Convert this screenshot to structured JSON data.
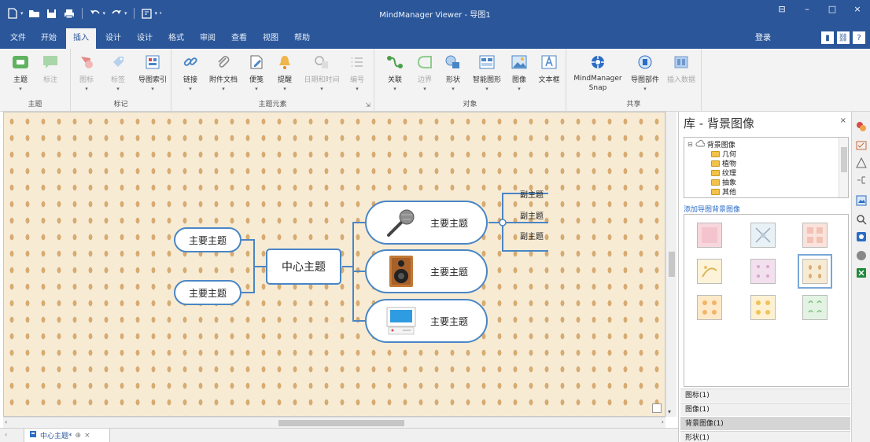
{
  "window": {
    "title": "MindManager Viewer - 导图1",
    "controls": [
      "⊟",
      "–",
      "□",
      "×"
    ]
  },
  "qat": {
    "icons": [
      "new-icon",
      "open-icon",
      "save-icon",
      "print-icon",
      "undo-icon",
      "redo-icon",
      "view-icon"
    ]
  },
  "tabs": [
    {
      "label": "文件",
      "active": false
    },
    {
      "label": "开始",
      "active": false
    },
    {
      "label": "插入",
      "active": true
    },
    {
      "label": "设计",
      "active": false
    },
    {
      "label": "设计",
      "active": false
    },
    {
      "label": "格式",
      "active": false
    },
    {
      "label": "审阅",
      "active": false
    },
    {
      "label": "查看",
      "active": false
    },
    {
      "label": "视图",
      "active": false
    },
    {
      "label": "帮助",
      "active": false
    }
  ],
  "signin": "登录",
  "ribbon": {
    "groups": [
      {
        "label": "主题",
        "buttons": [
          {
            "label": "主题",
            "icon": "topic-icon",
            "color": "#4aa04a",
            "disabled": false
          },
          {
            "label": "标注",
            "icon": "callout-icon",
            "color": "#4aa04a",
            "disabled": true
          }
        ]
      },
      {
        "label": "标记",
        "buttons": [
          {
            "label": "图标",
            "icon": "icon-marker-icon",
            "color": "#d94a4a",
            "disabled": true
          },
          {
            "label": "标签",
            "icon": "tag-icon",
            "color": "#4a86c5",
            "disabled": true
          },
          {
            "label": "导图索引",
            "icon": "index-icon",
            "color": "#4a86c5",
            "disabled": false
          }
        ]
      },
      {
        "label": "主题元素",
        "buttons": [
          {
            "label": "链接",
            "icon": "link-icon",
            "color": "#4a86c5",
            "disabled": false
          },
          {
            "label": "附件文档",
            "icon": "attachment-icon",
            "color": "#777777",
            "disabled": false
          },
          {
            "label": "便笺",
            "icon": "note-icon",
            "color": "#4a86c5",
            "disabled": false
          },
          {
            "label": "提醒",
            "icon": "alarm-icon",
            "color": "#e3a53a",
            "disabled": false
          },
          {
            "label": "日期和时间",
            "icon": "datetime-icon",
            "color": "#999999",
            "disabled": true
          },
          {
            "label": "编号",
            "icon": "numbering-icon",
            "color": "#999999",
            "disabled": true
          }
        ]
      },
      {
        "label": "对象",
        "buttons": [
          {
            "label": "关联",
            "icon": "relationship-icon",
            "color": "#4aa04a",
            "disabled": false
          },
          {
            "label": "边界",
            "icon": "boundary-icon",
            "color": "#4aa04a",
            "disabled": true
          },
          {
            "label": "形状",
            "icon": "shape-icon",
            "color": "#4a86c5",
            "disabled": false
          },
          {
            "label": "智能图形",
            "icon": "smartshape-icon",
            "color": "#4a86c5",
            "disabled": false
          },
          {
            "label": "图像",
            "icon": "image-icon",
            "color": "#4a86c5",
            "disabled": false
          },
          {
            "label": "文本框",
            "icon": "textbox-icon",
            "color": "#4a86c5",
            "disabled": false
          }
        ]
      },
      {
        "label": "共享",
        "buttons": [
          {
            "label": "MindManager Snap",
            "icon": "snap-icon",
            "color": "#2b6cc4",
            "disabled": false
          },
          {
            "label": "导图部件",
            "icon": "mappart-icon",
            "color": "#2b6cc4",
            "disabled": false
          },
          {
            "label": "插入数据",
            "icon": "insertdata-icon",
            "color": "#2b6cc4",
            "disabled": true
          }
        ]
      }
    ]
  },
  "map": {
    "central": "中心主题",
    "left_topics": [
      "主要主题",
      "主要主题"
    ],
    "right_topics": [
      {
        "label": "主要主题",
        "image": "microphone-icon"
      },
      {
        "label": "主要主题",
        "image": "speaker-icon"
      },
      {
        "label": "主要主题",
        "image": "monitor-icon"
      }
    ],
    "subtopics": [
      "副主题",
      "副主题",
      "副主题"
    ]
  },
  "doc_tab": {
    "label": "中心主题*",
    "pin": "⊕",
    "close": "×"
  },
  "panel": {
    "title": "库 - 背景图像",
    "close": "×",
    "tree": [
      {
        "label": "背景图像",
        "level": 0
      },
      {
        "label": "几何",
        "level": 1
      },
      {
        "label": "植物",
        "level": 1
      },
      {
        "label": "纹理",
        "level": 1
      },
      {
        "label": "抽象",
        "level": 1
      },
      {
        "label": "其他",
        "level": 1
      }
    ],
    "link": "添加导图背景图像",
    "thumbnails": [
      {
        "color": "#f7d7dd",
        "pattern": "plain"
      },
      {
        "color": "#e8f1f6",
        "pattern": "cross"
      },
      {
        "color": "#f9e3dc",
        "pattern": "grid"
      },
      {
        "color": "#fdf3d8",
        "pattern": "leaf"
      },
      {
        "color": "#f3e0ef",
        "pattern": "dots"
      },
      {
        "color": "#f7ebd4",
        "pattern": "drops",
        "selected": true
      },
      {
        "color": "#fde9c8",
        "pattern": "flower"
      },
      {
        "color": "#fdf1d2",
        "pattern": "flower2"
      },
      {
        "color": "#e3f3e3",
        "pattern": "leaf2"
      }
    ],
    "accordion": [
      {
        "label": "图标(1)",
        "active": false
      },
      {
        "label": "图像(1)",
        "active": false
      },
      {
        "label": "背景图像(1)",
        "active": true
      },
      {
        "label": "形状(1)",
        "active": false
      }
    ]
  },
  "strip_icons": [
    {
      "name": "library-icon",
      "color": "#d94a4a"
    },
    {
      "name": "task-icon",
      "color": "#777777"
    },
    {
      "name": "warning-icon",
      "color": "#777777"
    },
    {
      "name": "map-parts-icon",
      "color": "#777777"
    },
    {
      "name": "image-library-icon",
      "color": "#2b6cc4"
    },
    {
      "name": "search-icon",
      "color": "#555555"
    },
    {
      "name": "outlook-icon",
      "color": "#2b6cc4"
    },
    {
      "name": "gray-circle-icon",
      "color": "#888888"
    },
    {
      "name": "excel-icon",
      "color": "#1e8a3a"
    }
  ]
}
